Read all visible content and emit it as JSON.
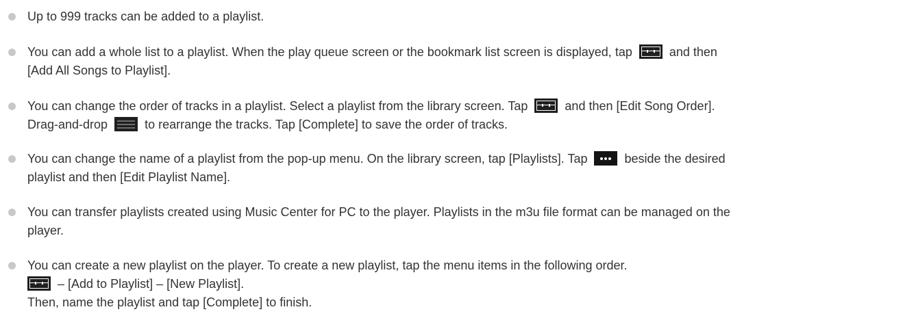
{
  "tips": [
    {
      "line1": "Up to 999 tracks can be added to a playlist."
    },
    {
      "line1_a": "You can add a whole list to a playlist. When the play queue screen or the bookmark list screen is displayed, tap",
      "line1_b": "and then",
      "line2": "[Add All Songs to Playlist]."
    },
    {
      "line1_a": "You can change the order of tracks in a playlist. Select a playlist from the library screen. Tap",
      "line1_b": "and then [Edit Song Order].",
      "line2_a": "Drag-and-drop",
      "line2_b": "to rearrange the tracks. Tap [Complete] to save the order of tracks."
    },
    {
      "line1_a": "You can change the name of a playlist from the pop-up menu. On the library screen, tap [Playlists]. Tap",
      "line1_b": "beside the desired",
      "line2": "playlist and then [Edit Playlist Name]."
    },
    {
      "line1": "You can transfer playlists created using Music Center for PC to the player. Playlists in the m3u file format can be managed on the",
      "line2": "player."
    },
    {
      "line1": "You can create a new playlist on the player. To create a new playlist, tap the menu items in the following order.",
      "line2": "– [Add to Playlist] – [New Playlist].",
      "line3": "Then, name the playlist and tap [Complete] to finish."
    }
  ],
  "icons": {
    "menu": "menu-icon",
    "drag": "drag-handle-icon",
    "more": "more-icon"
  },
  "colors": {
    "text": "#333333",
    "bullet": "#c8c8c8",
    "icon_bg": "#1f1f1f"
  }
}
